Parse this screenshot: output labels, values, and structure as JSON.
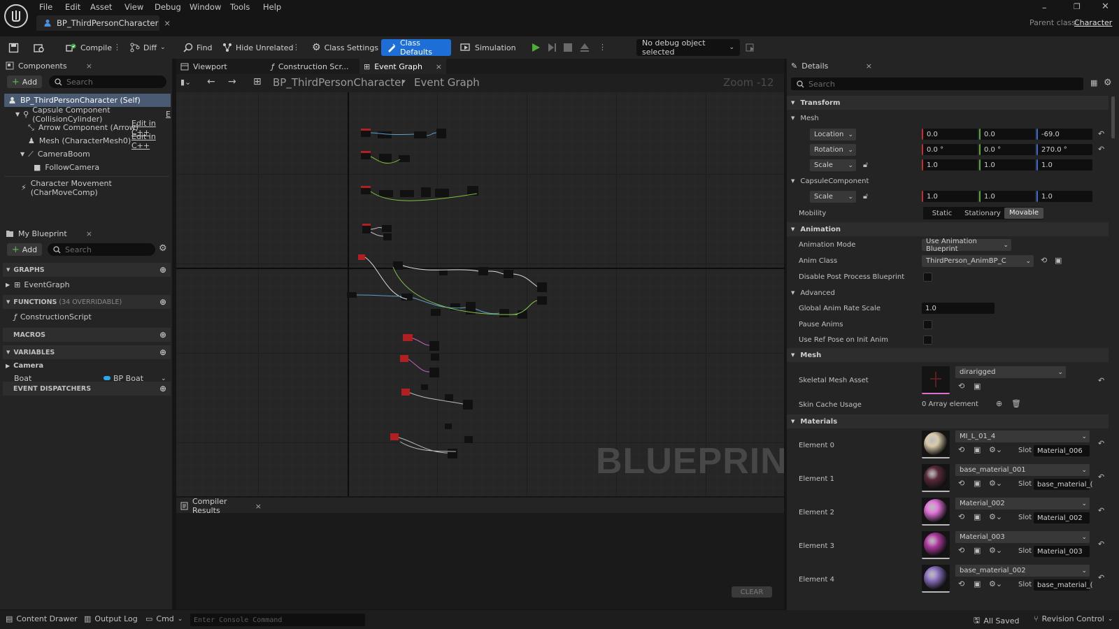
{
  "menu": [
    "File",
    "Edit",
    "Asset",
    "View",
    "Debug",
    "Window",
    "Tools",
    "Help"
  ],
  "document_tab": "BP_ThirdPersonCharacter",
  "parent_class": {
    "label": "Parent class:",
    "value": "Character"
  },
  "toolbar": {
    "compile": "Compile",
    "diff": "Diff",
    "find": "Find",
    "hide_unrelated": "Hide Unrelated",
    "class_settings": "Class Settings",
    "class_defaults": "Class Defaults",
    "simulation": "Simulation",
    "debug_object": "No debug object selected"
  },
  "components": {
    "tab": "Components",
    "add": "Add",
    "search_placeholder": "Search",
    "items": [
      {
        "label": "BP_ThirdPersonCharacter (Self)",
        "extra": ""
      },
      {
        "label": "Capsule Component (CollisionCylinder)",
        "extra": "E"
      },
      {
        "label": "Arrow Component (Arrow)",
        "extra": "Edit in C++"
      },
      {
        "label": "Mesh (CharacterMesh0)",
        "extra": "Edit in C++"
      },
      {
        "label": "CameraBoom",
        "extra": ""
      },
      {
        "label": "FollowCamera",
        "extra": ""
      },
      {
        "label": "Character Movement (CharMoveComp)",
        "extra": ""
      }
    ]
  },
  "my_blueprint": {
    "tab": "My Blueprint",
    "add": "Add",
    "search_placeholder": "Search",
    "graphs": "GRAPHS",
    "event_graph": "EventGraph",
    "functions": "FUNCTIONS",
    "functions_count": "(34 OVERRIDABLE)",
    "construction_script": "ConstructionScript",
    "macros": "MACROS",
    "variables": "VARIABLES",
    "camera": "Camera",
    "var_name": "Boat",
    "var_type": "BP Boat",
    "event_dispatchers": "EVENT DISPATCHERS"
  },
  "graph_tabs": [
    "Viewport",
    "Construction Scr...",
    "Event Graph"
  ],
  "breadcrumb": {
    "root": "BP_ThirdPersonCharacter",
    "current": "Event Graph"
  },
  "zoom": "Zoom -12",
  "watermark": "BLUEPRINT",
  "compiler": {
    "tab": "Compiler Results",
    "clear": "CLEAR"
  },
  "details": {
    "tab": "Details",
    "search_placeholder": "Search",
    "transform": "Transform",
    "mesh_sub": "Mesh",
    "location": {
      "label": "Location",
      "x": "0.0",
      "y": "0.0",
      "z": "-69.0"
    },
    "rotation": {
      "label": "Rotation",
      "x": "0.0 °",
      "y": "0.0 °",
      "z": "270.0 °"
    },
    "scale": {
      "label": "Scale",
      "x": "1.0",
      "y": "1.0",
      "z": "1.0"
    },
    "capsule": "CapsuleComponent",
    "capsule_scale": {
      "label": "Scale",
      "x": "1.0",
      "y": "1.0",
      "z": "1.0"
    },
    "mobility": {
      "label": "Mobility",
      "options": [
        "Static",
        "Stationary",
        "Movable"
      ],
      "selected": "Movable"
    },
    "animation": "Animation",
    "animation_mode": {
      "label": "Animation Mode",
      "value": "Use Animation Blueprint"
    },
    "anim_class": {
      "label": "Anim Class",
      "value": "ThirdPerson_AnimBP_C"
    },
    "disable_post": "Disable Post Process Blueprint",
    "advanced": "Advanced",
    "global_rate": {
      "label": "Global Anim Rate Scale",
      "value": "1.0"
    },
    "pause_anims": "Pause Anims",
    "ref_pose": "Use Ref Pose on Init Anim",
    "mesh": "Mesh",
    "skeletal": {
      "label": "Skeletal Mesh Asset",
      "value": "dirarigged"
    },
    "skin_cache": {
      "label": "Skin Cache Usage",
      "value": "0 Array element"
    },
    "materials": "Materials",
    "slot_label": "Slot",
    "elements": [
      {
        "label": "Element 0",
        "material": "MI_L_01_4",
        "slot": "Material_006",
        "color": "#d8c8a8"
      },
      {
        "label": "Element 1",
        "material": "base_material_001",
        "slot": "base_material_(",
        "color": "#5a2a3a"
      },
      {
        "label": "Element 2",
        "material": "Material_002",
        "slot": "Material_002",
        "color": "#e070d8"
      },
      {
        "label": "Element 3",
        "material": "Material_003",
        "slot": "Material_003",
        "color": "#b03aa0"
      },
      {
        "label": "Element 4",
        "material": "base_material_002",
        "slot": "base_material_(",
        "color": "#8a70c0"
      }
    ]
  },
  "status": {
    "content_drawer": "Content Drawer",
    "output_log": "Output Log",
    "cmd": "Cmd",
    "console_placeholder": "Enter Console Command",
    "saved": "All Saved",
    "revision": "Revision Control"
  }
}
